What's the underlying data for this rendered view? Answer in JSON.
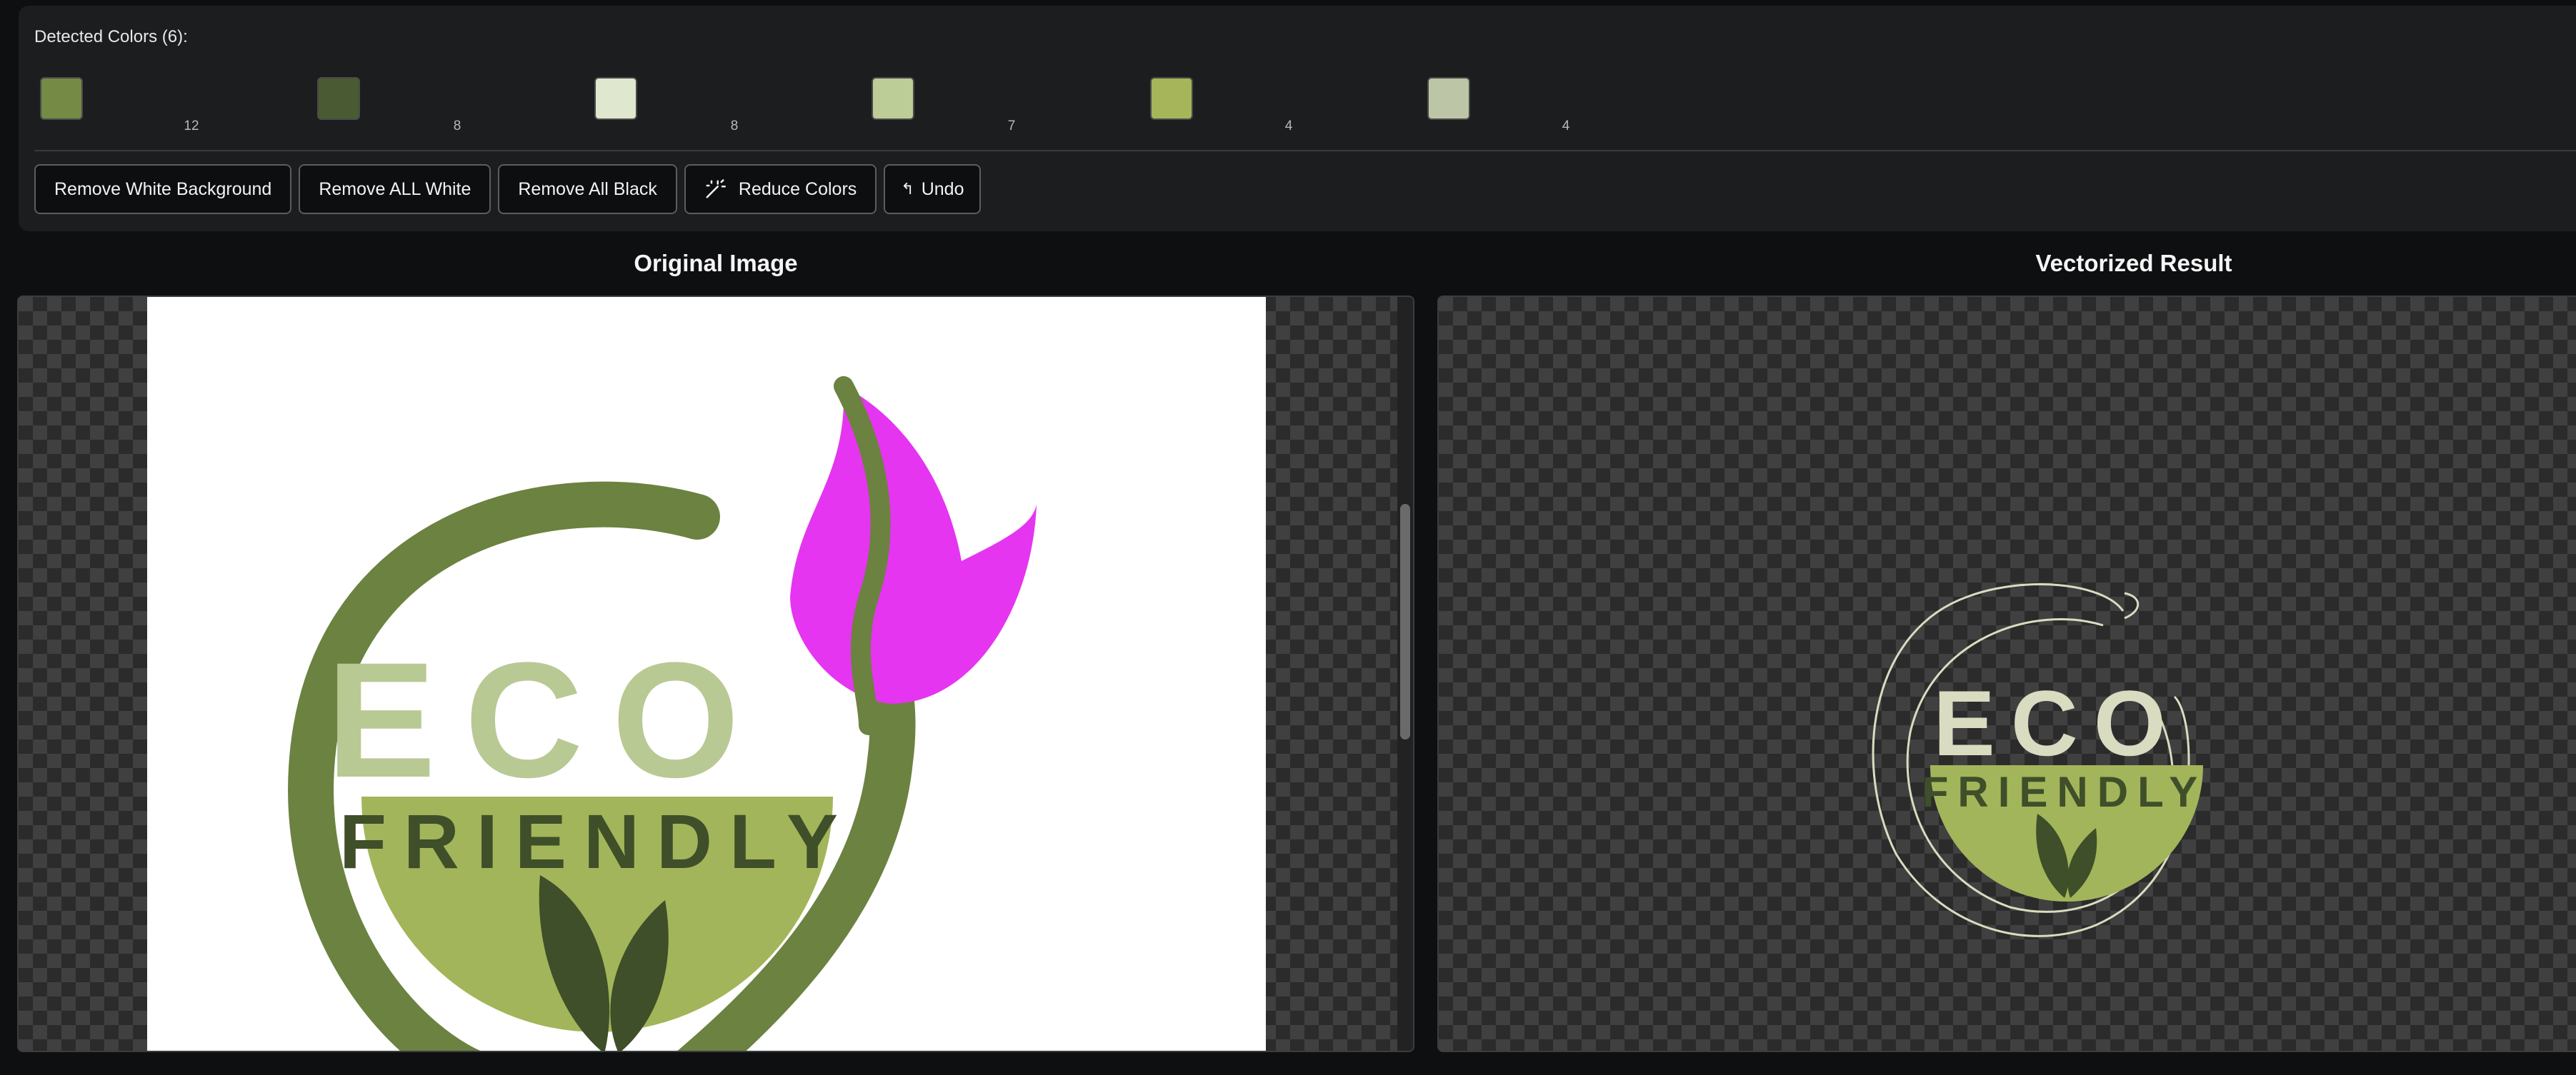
{
  "colors_panel": {
    "title": "Detected Colors (6):",
    "swatches": [
      {
        "color": "#758a45",
        "count": "12"
      },
      {
        "color": "#4a5a32",
        "count": "8"
      },
      {
        "color": "#dfe7cf",
        "count": "8"
      },
      {
        "color": "#bccd98",
        "count": "7"
      },
      {
        "color": "#a6b55a",
        "count": "4"
      },
      {
        "color": "#bcc5a6",
        "count": "4"
      }
    ]
  },
  "toolbar": {
    "remove_white_bg": "Remove White Background",
    "remove_all_white": "Remove ALL White",
    "remove_all_black": "Remove All Black",
    "reduce_colors": "Reduce Colors",
    "undo": "Undo"
  },
  "original": {
    "heading": "Original Image",
    "logo_word1": "ECO",
    "logo_word2": "FRIENDLY"
  },
  "result": {
    "heading": "Vectorized Result",
    "logo_word1": "ECO",
    "logo_word2": "FRIENDLY"
  },
  "palette": {
    "dark_green": "#6c8240",
    "light_green": "#b8c994",
    "bowl_green": "#a3b55a",
    "leaf_dark": "#3e4f29",
    "magenta": "#e535f0",
    "outline_cream": "#d9dcc0"
  }
}
